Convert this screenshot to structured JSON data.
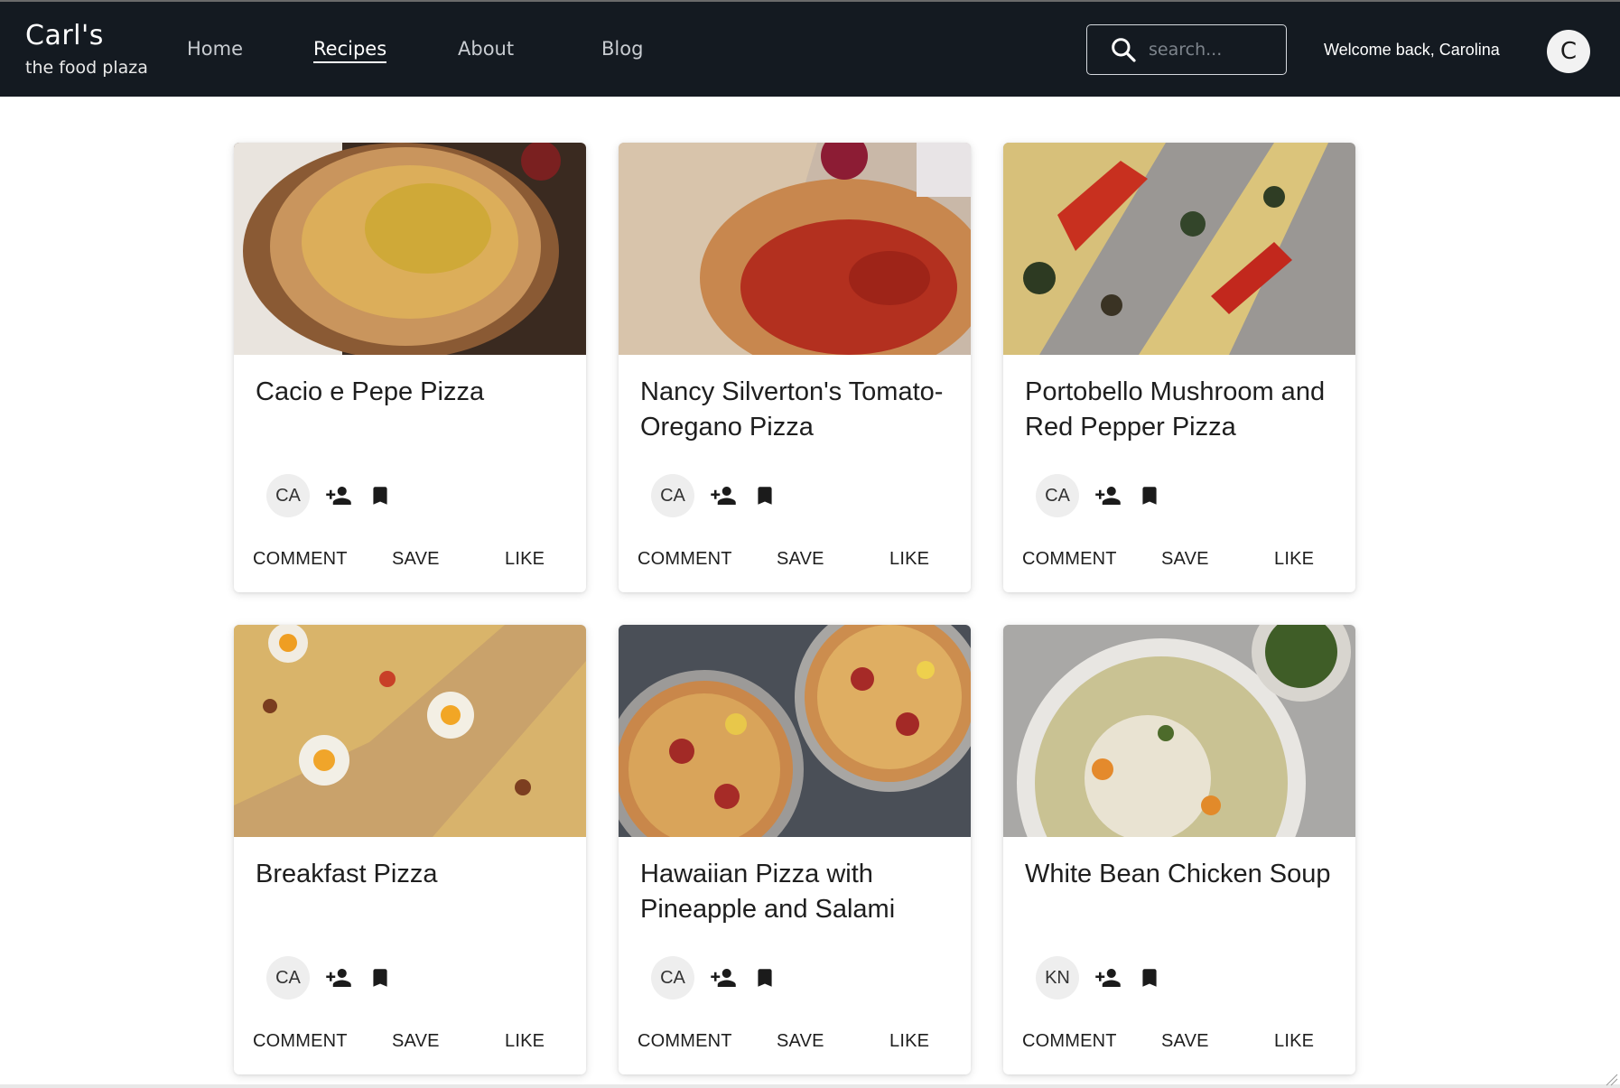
{
  "header": {
    "brand_title": "Carl's",
    "brand_subtitle": "the food plaza",
    "nav": [
      {
        "label": "Home",
        "active": false
      },
      {
        "label": "Recipes",
        "active": true
      },
      {
        "label": "About",
        "active": false
      },
      {
        "label": "Blog",
        "active": false
      }
    ],
    "search_placeholder": "search...",
    "welcome_text": "Welcome back, Carolina",
    "avatar_initial": "C"
  },
  "cards": [
    {
      "title": "Cacio e Pepe Pizza",
      "author_initials": "CA",
      "image": "pizza-photo",
      "actions": {
        "comment": "COMMENT",
        "save": "SAVE",
        "like": "LIKE"
      }
    },
    {
      "title": "Nancy Silverton's Tomato-Oregano Pizza",
      "author_initials": "CA",
      "image": "pizza-photo",
      "actions": {
        "comment": "COMMENT",
        "save": "SAVE",
        "like": "LIKE"
      }
    },
    {
      "title": "Portobello Mushroom and Red Pepper Pizza",
      "author_initials": "CA",
      "image": "pizza-photo",
      "actions": {
        "comment": "COMMENT",
        "save": "SAVE",
        "like": "LIKE"
      }
    },
    {
      "title": "Breakfast Pizza",
      "author_initials": "CA",
      "image": "pizza-photo",
      "actions": {
        "comment": "COMMENT",
        "save": "SAVE",
        "like": "LIKE"
      }
    },
    {
      "title": "Hawaiian Pizza with Pineapple and Salami",
      "author_initials": "CA",
      "image": "pizza-photo",
      "actions": {
        "comment": "COMMENT",
        "save": "SAVE",
        "like": "LIKE"
      }
    },
    {
      "title": "White Bean Chicken Soup",
      "author_initials": "KN",
      "image": "soup-photo",
      "actions": {
        "comment": "COMMENT",
        "save": "SAVE",
        "like": "LIKE"
      }
    }
  ],
  "colors": {
    "header_bg": "#141a21",
    "text": "#1e1e1e",
    "author_bg": "#eeeeee"
  },
  "icons": {
    "search": "search-icon",
    "follow": "person-add-icon",
    "bookmark": "bookmark-icon"
  }
}
